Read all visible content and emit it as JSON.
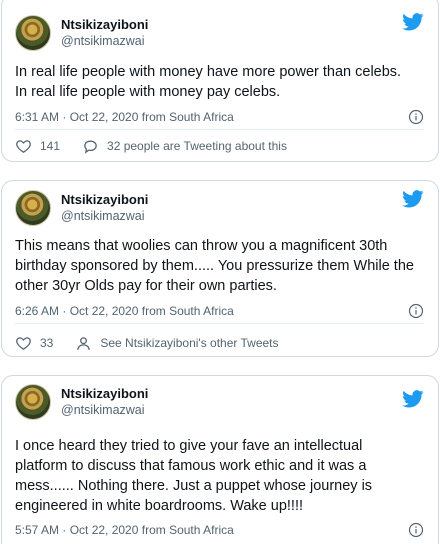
{
  "tweets": [
    {
      "display_name": "Ntsikizayiboni",
      "handle": "@ntsikimazwai",
      "lines": [
        "In real life people with money have more power than celebs.",
        "In real life people with money pay celebs."
      ],
      "timestamp": "6:31 AM · Oct 22, 2020 from South Africa",
      "likes": "141",
      "secondary_action": "32 people are Tweeting about this"
    },
    {
      "display_name": "Ntsikizayiboni",
      "handle": "@ntsikimazwai",
      "lines": [
        "This means that woolies can throw you a magnificent 30th",
        "birthday sponsored by them..... You pressurize them While the",
        "other 30yr Olds pay for their own parties."
      ],
      "timestamp": "6:26 AM · Oct 22, 2020 from South Africa",
      "likes": "33",
      "secondary_action": "See Ntsikizayiboni's other Tweets"
    },
    {
      "display_name": "Ntsikizayiboni",
      "handle": "@ntsikimazwai",
      "lines": [
        "I once heard they tried to give your fave an intellectual",
        "platform to discuss that famous work ethic and it was a",
        "mess...... Nothing there. Just a puppet whose journey is",
        "engineered in white boardrooms. Wake up!!!!"
      ],
      "timestamp": "5:57 AM · Oct 22, 2020 from South Africa"
    }
  ],
  "colors": {
    "twitter_blue": "#1d9bf0",
    "secondary_text": "#536471",
    "border": "#cfd9de"
  },
  "icons": {
    "brand": "twitter-bird-icon",
    "info": "info-icon",
    "like": "heart-icon",
    "comment": "comment-icon",
    "profile": "person-icon"
  }
}
